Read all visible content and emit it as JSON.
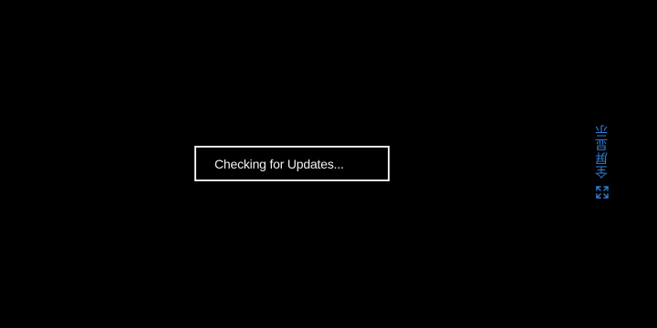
{
  "status": {
    "message": "Checking for Updates..."
  },
  "fullscreen": {
    "label": "全屏显示",
    "icon": "fullscreen-expand-icon",
    "color": "#2f7fd6"
  },
  "colors": {
    "background": "#000000",
    "box_border": "#e6e6e6",
    "text": "#f2f2f2"
  }
}
